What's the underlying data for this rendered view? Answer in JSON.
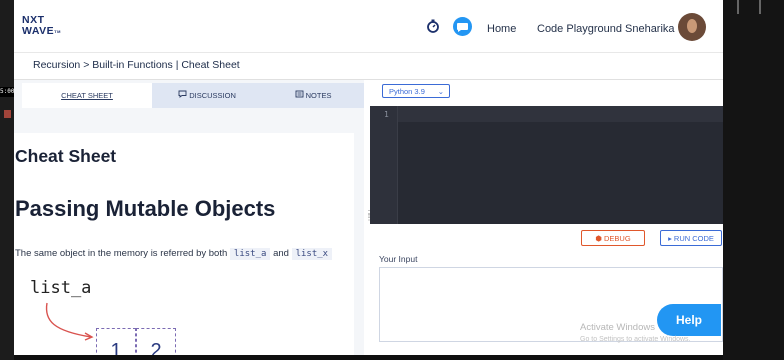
{
  "brand": {
    "line1": "NXT",
    "line2": "WAVE",
    "tm": "TM"
  },
  "header": {
    "nav": [
      "Home",
      "Code Playground"
    ],
    "username": "Sneharika"
  },
  "breadcrumb": "Recursion > Built-in Functions | Cheat Sheet",
  "tabs": [
    {
      "label": "CHEAT SHEET",
      "icon": ""
    },
    {
      "label": "DISCUSSION",
      "icon": "chat-bubble-icon"
    },
    {
      "label": "NOTES",
      "icon": "notes-icon"
    }
  ],
  "content": {
    "title": "Cheat Sheet",
    "heading": "Passing Mutable Objects",
    "para_prefix": "The same object in the memory is referred by both",
    "code1": "list_a",
    "and": "and",
    "code2": "list_x",
    "diagram_label": "list_a",
    "cells": [
      "1",
      "2"
    ]
  },
  "editor": {
    "language": "Python 3.9",
    "line_numbers": [
      "1"
    ],
    "debug_label": "DEBUG",
    "run_label": "RUN CODE",
    "input_label": "Your Input"
  },
  "help_label": "Help",
  "overlay": {
    "time": "5:00",
    "watermark1": "Activate Windows",
    "watermark2": "Go to Settings to activate Windows."
  },
  "colors": {
    "accent": "#2396f3",
    "brand": "#1b2f6b",
    "debug": "#e0572b",
    "run": "#3b6bd6"
  }
}
